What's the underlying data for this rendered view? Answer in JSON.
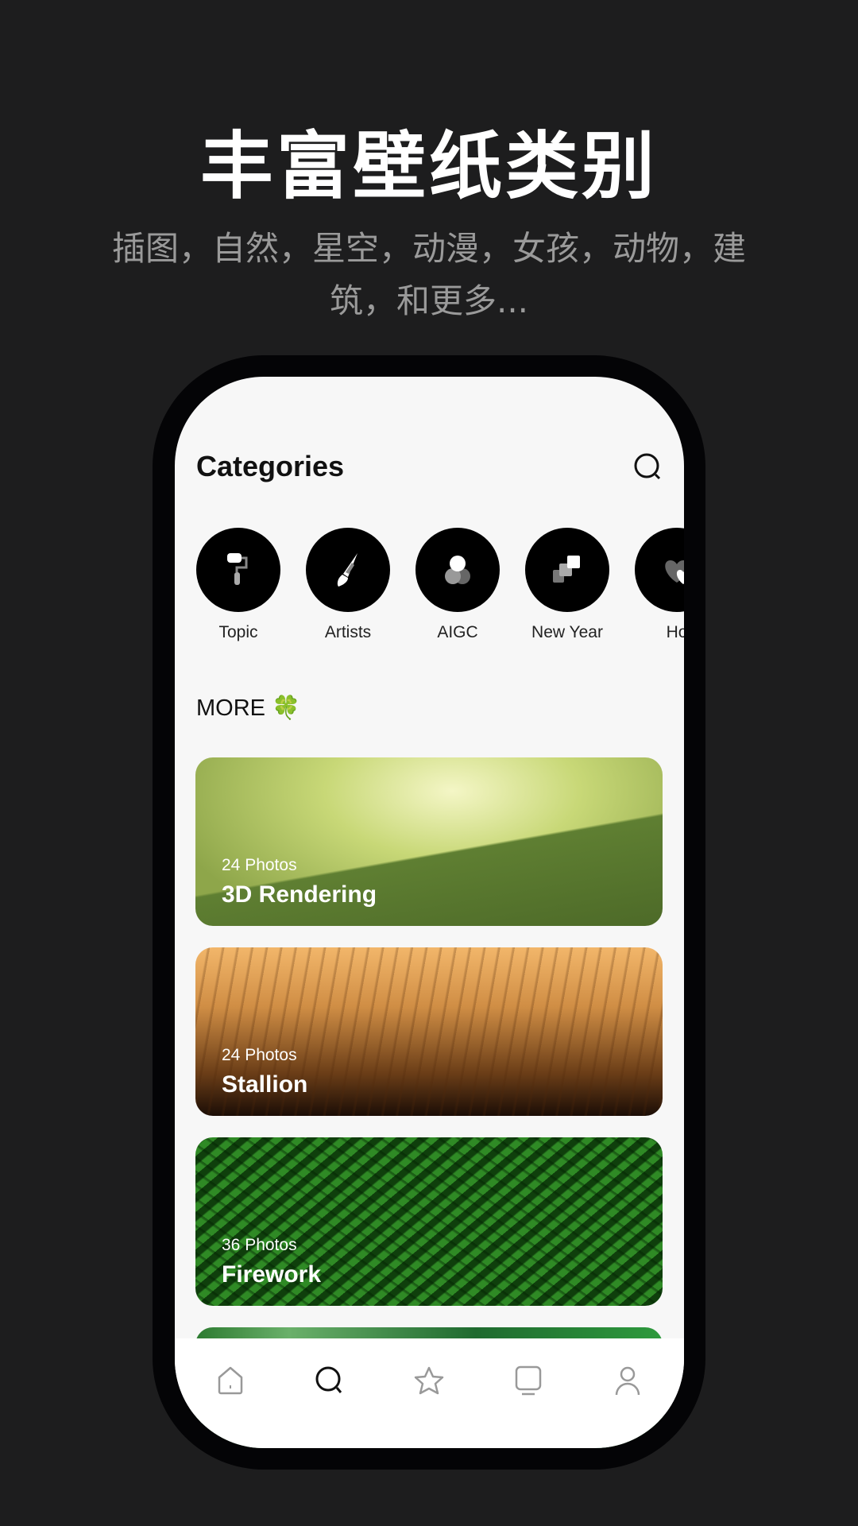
{
  "headline": "丰富壁纸类别",
  "subheadline": "插图，自然，星空，动漫，女孩，动物，建筑，和更多...",
  "screen": {
    "title": "Categories",
    "categories": [
      {
        "label": "Topic",
        "icon": "paint-roller-icon"
      },
      {
        "label": "Artists",
        "icon": "brush-icon"
      },
      {
        "label": "AIGC",
        "icon": "circles-icon"
      },
      {
        "label": "New Year",
        "icon": "squares-icon"
      },
      {
        "label": "Ho",
        "icon": "hearts-icon"
      }
    ],
    "more_label": "MORE 🍀",
    "cards": [
      {
        "count": "24 Photos",
        "name": "3D Rendering"
      },
      {
        "count": "24 Photos",
        "name": "Stallion"
      },
      {
        "count": "36 Photos",
        "name": "Firework"
      }
    ],
    "nav": [
      "home-icon",
      "search-icon",
      "star-icon",
      "display-icon",
      "profile-icon"
    ],
    "active_nav": "search-icon"
  }
}
